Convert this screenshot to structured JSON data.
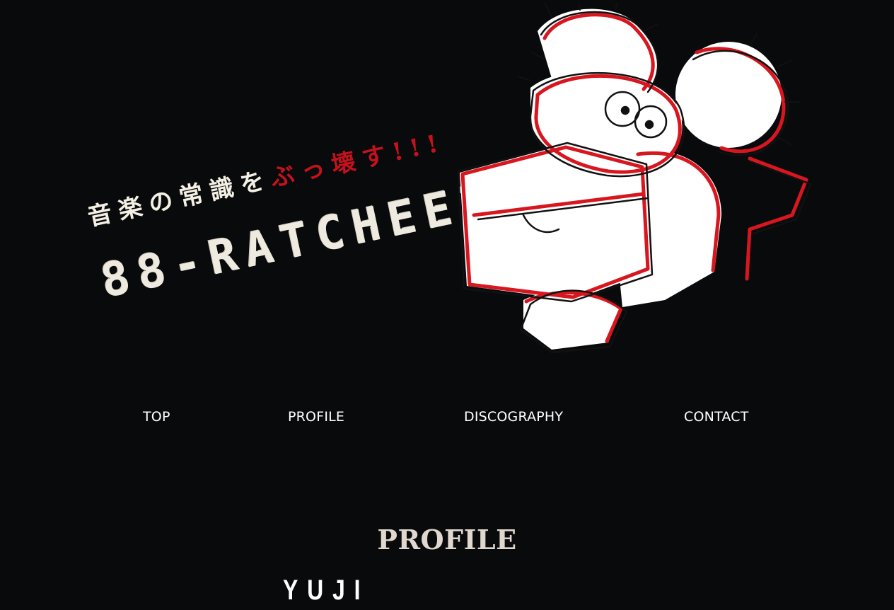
{
  "hero": {
    "tagline_prefix": "音楽の常識を",
    "tagline_accent": "ぶっ壊す!!!",
    "band_name": "88-RATCHEEZ",
    "mascot_icon": "rat-mascot-illustration-icon",
    "colors": {
      "accent_red": "#c3121c",
      "background": "#090a0c",
      "cream": "#f3f0e8"
    }
  },
  "nav": {
    "items": [
      {
        "label": "TOP"
      },
      {
        "label": "PROFILE"
      },
      {
        "label": "DISCOGRAPHY"
      },
      {
        "label": "CONTACT"
      }
    ]
  },
  "profile": {
    "title": "PROFILE",
    "member_name": "YUJI"
  }
}
